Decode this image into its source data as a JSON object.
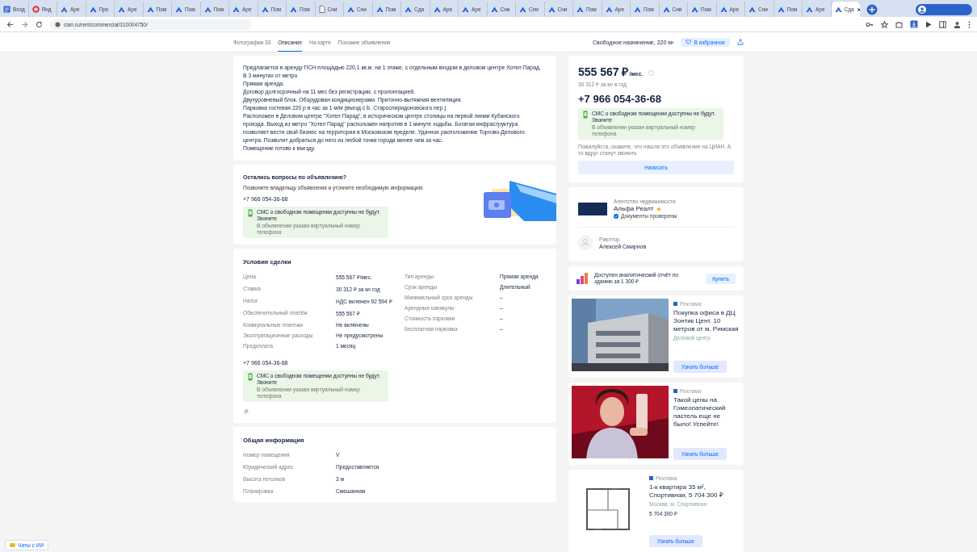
{
  "browser": {
    "tabs": [
      {
        "title": "Вход",
        "kind": "site",
        "selected": false
      },
      {
        "title": "Янд",
        "kind": "browser",
        "selected": false
      },
      {
        "title": "Аре",
        "kind": "cian",
        "selected": false
      },
      {
        "title": "Про",
        "kind": "cian",
        "selected": false
      },
      {
        "title": "Аре",
        "kind": "cian",
        "selected": false
      },
      {
        "title": "Пом",
        "kind": "cian",
        "selected": false
      },
      {
        "title": "Пом",
        "kind": "cian",
        "selected": false
      },
      {
        "title": "Пом",
        "kind": "cian",
        "selected": false
      },
      {
        "title": "Аре",
        "kind": "cian",
        "selected": false
      },
      {
        "title": "Пом",
        "kind": "cian",
        "selected": false
      },
      {
        "title": "Пом",
        "kind": "cian",
        "selected": false
      },
      {
        "title": "Сни",
        "kind": "file",
        "selected": false
      },
      {
        "title": "Сни",
        "kind": "cian",
        "selected": false
      },
      {
        "title": "Пом",
        "kind": "cian",
        "selected": false
      },
      {
        "title": "Сда",
        "kind": "cian",
        "selected": false
      },
      {
        "title": "Аре",
        "kind": "cian",
        "selected": false
      },
      {
        "title": "Аре",
        "kind": "cian",
        "selected": false
      },
      {
        "title": "Сни",
        "kind": "cian",
        "selected": false
      },
      {
        "title": "Сни",
        "kind": "cian",
        "selected": false
      },
      {
        "title": "Сни",
        "kind": "cian",
        "selected": false
      },
      {
        "title": "Пом",
        "kind": "cian",
        "selected": false
      },
      {
        "title": "Аре",
        "kind": "cian",
        "selected": false
      },
      {
        "title": "Пом",
        "kind": "cian",
        "selected": false
      },
      {
        "title": "Сни",
        "kind": "cian",
        "selected": false
      },
      {
        "title": "Пом",
        "kind": "cian",
        "selected": false
      },
      {
        "title": "Аре",
        "kind": "cian",
        "selected": false
      },
      {
        "title": "Сни",
        "kind": "cian",
        "selected": false
      },
      {
        "title": "Пом",
        "kind": "cian",
        "selected": false
      },
      {
        "title": "Аре",
        "kind": "cian",
        "selected": false
      },
      {
        "title": "Сда",
        "kind": "cian",
        "selected": true
      }
    ],
    "address": "cian.ru/rent/commercial/310004750/"
  },
  "nav": {
    "links": [
      {
        "label": "Фотографии 33",
        "selected": false
      },
      {
        "label": "Описание",
        "selected": true
      },
      {
        "label": "На карте",
        "selected": false
      },
      {
        "label": "Похожие объявления",
        "selected": false
      }
    ],
    "title": "Свободное назначение, 220 м²",
    "favorite": "В избранное"
  },
  "description": {
    "paragraphs": [
      "Предлагается в аренду ПСН площадью 220,1 кв.м. на 1 этаже, с отдельным входом в деловом центре Хотел Парад.",
      "В 3 минутах от метро",
      "Прямая аренда.",
      "Договор долгосрочный на 11 мес без регистрации, с пролонгацией.",
      "Двухуровневый блок. Оборудован кондиционерами. Приточно-вытяжная вентиляция.",
      "Парковка гостевая 220 р в час за 1 м/м (въезд с Б. Староспиридоновского пер.)",
      "Расположен в Деловом центре \"Хотел Парад\", в историческом центре столицы на первой линии Кубанского проезда. Выход из метро \"Хотел Парад\" расположен напротив в 1 минуте ходьбы. Богатая инфраструктура позволяет вести свой бизнес на территории в Московском пределе. Удачное расположение Торгово-Делового центра. Позволит добраться до него из любой точки города менее чем за час.",
      "Помещение готово к въезду."
    ]
  },
  "contact": {
    "title": "Остались вопросы по объявлению?",
    "text": "Позвоните владельцу объявления и уточните необходимую информацию",
    "phone": "+7 966 054-36-68",
    "sms": {
      "title": "СМС о свободном помещении доступны не будут. Звоните",
      "note": "В объявлении указан виртуальный номер телефона"
    }
  },
  "terms": {
    "title": "Условия сделки",
    "left": [
      {
        "label": "Цена",
        "value": "555 567 ₽/мес."
      },
      {
        "label": "Ставка",
        "value": "30 312 ₽ за м² год"
      },
      {
        "label": "Налог",
        "value": "НДС включен 92 594 ₽"
      },
      {
        "label": "Обеспечительный платёж",
        "value": "555 567 ₽"
      },
      {
        "label": "Коммунальные платежи",
        "value": "Не включены"
      },
      {
        "label": "Эксплуатационные расходы",
        "value": "Не предусмотрены"
      },
      {
        "label": "Предоплата",
        "value": "1 месяц"
      }
    ],
    "right": [
      {
        "label": "Тип аренды",
        "value": "Прямая аренда"
      },
      {
        "label": "Срок аренды",
        "value": "Длительный"
      },
      {
        "label": "Минимальный срок аренды",
        "value": "–"
      },
      {
        "label": "Арендные каникулы",
        "value": "–"
      },
      {
        "label": "Стоимость парковки",
        "value": "–"
      },
      {
        "label": "Бесплатная парковка",
        "value": "–"
      }
    ],
    "phone": "+7 966 054-36-68",
    "sms": {
      "title": "СМС о свободном помещении доступны не будут. Звоните",
      "note": "В объявлении указан виртуальный номер телефона"
    }
  },
  "info": {
    "title": "Общая информация",
    "rows": [
      {
        "label": "Номер помещения",
        "value": "V"
      },
      {
        "label": "Юридический адрес",
        "value": "Предоставляется"
      },
      {
        "label": "Высота потолков",
        "value": "3 м"
      },
      {
        "label": "Планировка",
        "value": "Смешанная"
      }
    ]
  },
  "price_card": {
    "price": "555 567 ₽",
    "period": "/мес.",
    "rate": "30 312 ₽ за м² в год",
    "phone": "+7 966 054-36-68",
    "sms": {
      "title": "СМС о свободном помещении доступны не будут. Звоните",
      "note": "В объявлении указан виртуальный номер телефона"
    },
    "hint": "Пожалуйста, скажите, что нашли это объявление на ЦИАН. А то вдруг станут звонить",
    "button": "Написать"
  },
  "agency": {
    "caption": "Агентство недвижимости",
    "name": "Альфа Реалт",
    "verified": "Документы проверены",
    "agent_role": "Риелтор",
    "agent_name": "Алексей Смирнов"
  },
  "report": {
    "text": "Доступен аналитический отчёт по зданию за 1 300 ₽",
    "button": "Купить"
  },
  "ads": [
    {
      "sponsor": "Реклама",
      "title": "Покупка офиса в ДЦ Зонтик Цент. 10 метров от м. Римская",
      "subtitle": "Деловой центр",
      "button": "Узнать больше"
    },
    {
      "sponsor": "Реклама",
      "title": "Такой цены на Гомеопатический пастель еще не было! Успейте!",
      "button": "Узнать больше"
    },
    {
      "kind": "plan",
      "sponsor": "Реклама",
      "title": "1-к квартира 35 м², Спортивная, 5 704 300 ₽",
      "subtitle": "Москва, м. Спортивная",
      "price": "5 704 300 ₽",
      "button": "Узнать больше"
    }
  ],
  "chat": {
    "label": "Чаты с ИИ"
  }
}
